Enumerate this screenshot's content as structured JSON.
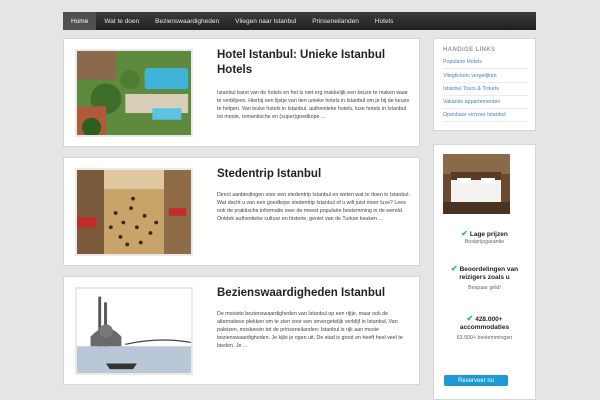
{
  "nav": {
    "items": [
      {
        "label": "Home",
        "active": true
      },
      {
        "label": "Wat te doen"
      },
      {
        "label": "Bezienswaardigheden"
      },
      {
        "label": "Vliegen naar Istanbul"
      },
      {
        "label": "Prinseneilanden"
      },
      {
        "label": "Hotels"
      }
    ]
  },
  "posts": [
    {
      "title": "Hotel Istanbul: Unieke Istanbul Hotels",
      "excerpt": "Istanbul barst van de hotels en het is niet erg makkelijk een keuze te maken waar te verblijven. Hierbij een lijstje van tien unieke hotels in Istanbul om je bij de keuze te helpen. Van leuke hotels in Istanbul, authentieke hotels, luxe hotels in Istanbul tot mooie, romantische en (super)goedkope ..."
    },
    {
      "title": "Stedentrip Istanbul",
      "excerpt": "Direct aanbiedingen voor een stedentrip Istanbul en weten wat te doen in Istanbul. Wat dacht u van een goedkope stedentrip Istanbul of u wilt juist meer luxe? Lees ook de praktische informatie over de meest populaire bestemming in de wereld. Ontdek authentieke cultuur en historie, geniet van de Turkse keuken ..."
    },
    {
      "title": "Bezienswaardigheden Istanbul",
      "excerpt": "De mooiste bezienswaardigheden van Istanbul op een rijtje, maar ook de alternatieve plekken om te zien voor een onvergetelijk verblijf in Istanbul. Van paleizen, moskeeën tot de prinseneilanden: Istanbul is rijk aan mooie bezienswaardigheden. Je kijkt je ogen uit. De stad is groot en heeft heel veel te bieden. Je ..."
    }
  ],
  "sidebar": {
    "links_title": "HANDIGE LINKS",
    "links": [
      "Populaire Hotels",
      "Vliegtickets vergelijken",
      "Istanbul Tours & Tickets",
      "Vakantie appartementen",
      "Openbaar vervoer Istanbul"
    ],
    "features": [
      {
        "title": "Lage prijzen",
        "sub": "Bestprijsgarantie"
      },
      {
        "title": "Beoordelingen van reizigers zoals u",
        "sub": "Bespaar geld!"
      },
      {
        "title": "428.000+ accommodaties",
        "sub": "63.500+ bestemmingen"
      }
    ],
    "reserve_label": "Reserveer nu"
  },
  "colors": {
    "accent": "#1d9ad6",
    "link": "#4b82b0",
    "nav": "#2a2a2a"
  }
}
